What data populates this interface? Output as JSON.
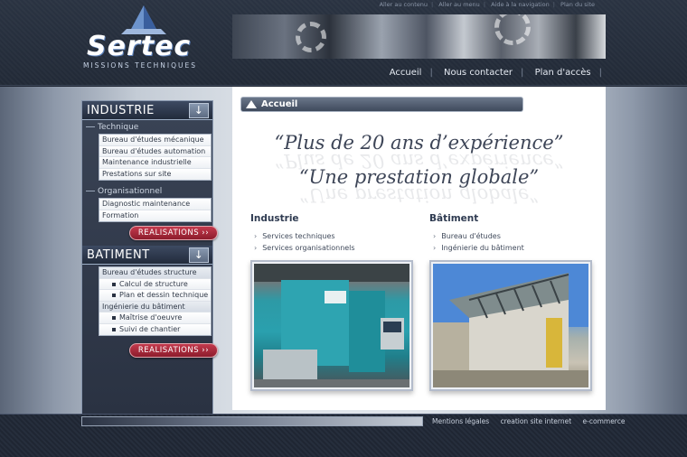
{
  "header": {
    "logo": {
      "brand": "Sertec",
      "tagline": "MISSIONS TECHNIQUES"
    },
    "skip_links": [
      "Aller au contenu",
      "Aller au menu",
      "Aide à la navigation",
      "Plan du site"
    ],
    "nav": [
      "Accueil",
      "Nous contacter",
      "Plan d'accès"
    ]
  },
  "sidebar": {
    "industrie": {
      "title": "INDUSTRIE",
      "groups": [
        {
          "label": "Technique",
          "items": [
            "Bureau d'études mécanique",
            "Bureau d'études automation",
            "Maintenance industrielle",
            "Prestations sur site"
          ]
        },
        {
          "label": "Organisationnel",
          "items": [
            "Diagnostic maintenance",
            "Formation"
          ]
        }
      ],
      "realisations": "REALISATIONS ››"
    },
    "batiment": {
      "title": "BATIMENT",
      "items": [
        {
          "label": "Bureau d'études structure",
          "head": true
        },
        {
          "label": "Calcul de structure",
          "sub": true
        },
        {
          "label": "Plan et dessin technique",
          "sub": true
        },
        {
          "label": "Ingénierie du bâtiment",
          "head": false
        },
        {
          "label": "Maîtrise d'oeuvre",
          "sub": true
        },
        {
          "label": "Suivi de chantier",
          "sub": true
        }
      ],
      "realisations": "REALISATIONS ››"
    }
  },
  "content": {
    "breadcrumb": "Accueil",
    "quote1": "“Plus de 20 ans d’expérience”",
    "quote2": "“Une prestation globale”",
    "industrie": {
      "title": "Industrie",
      "links": [
        "Services techniques",
        "Services organisationnels"
      ]
    },
    "batiment": {
      "title": "Bâtiment",
      "links": [
        "Bureau d'études",
        "Ingénierie du bâtiment"
      ]
    }
  },
  "footer": {
    "links": [
      "Mentions légales",
      "creation site internet",
      "e-commerce"
    ]
  },
  "icons": {
    "chevron": "›",
    "down_arrow": "↓"
  }
}
